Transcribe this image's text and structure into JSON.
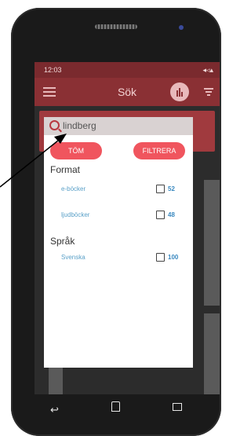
{
  "status_bar": {
    "time": "12:03",
    "icons_right": "◂◃▴"
  },
  "app_bar": {
    "title": "Sök"
  },
  "search": {
    "query": "lindberg"
  },
  "filter_panel": {
    "clear_button": "TÖM",
    "filter_button": "FILTRERA",
    "sections": [
      {
        "heading": "Format",
        "options": [
          {
            "label": "e-böcker",
            "count": "52"
          },
          {
            "label": "ljudböcker",
            "count": "48"
          }
        ]
      },
      {
        "heading": "Språk",
        "options": [
          {
            "label": "Svenska",
            "count": "100"
          }
        ]
      }
    ]
  },
  "colors": {
    "accent": "#f0555e",
    "app_bar": "#8a3034",
    "link": "#5aa0c8"
  }
}
